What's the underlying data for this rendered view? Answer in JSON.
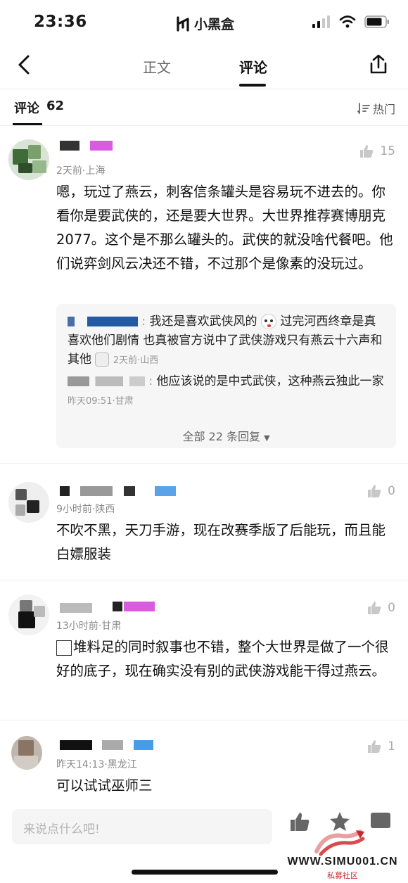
{
  "status_bar": {
    "time": "23:36",
    "app_name": "小黑盒"
  },
  "nav": {
    "tab_body": "正文",
    "tab_comments": "评论",
    "active_tab": "评论"
  },
  "comments_header": {
    "label": "评论",
    "count": "62",
    "sort_label": "热门"
  },
  "comments": [
    {
      "meta": "2天前·上海",
      "text": "嗯，玩过了燕云，刺客信条罐头是容易玩不进去的。你看你是要武侠的，还是要大世界。大世界推荐赛博朋克2077。这个是不那么罐头的。武侠的就没啥代餐吧。他们说弈剑风云决还不错，不过那个是像素的没玩过。",
      "likes": "15",
      "replies": [
        {
          "text": "我还是喜欢武侠风的",
          "text2": "过完河西终章是真喜欢他们剧情 也真被官方说中了武侠游戏只有燕云十六声和其他",
          "meta": "2天前·山西"
        },
        {
          "text": "他应该说的是中式武侠，这种燕云独此一家",
          "meta": "昨天09:51·甘肃"
        }
      ],
      "more_replies": "全部 22 条回复"
    },
    {
      "meta": "9小时前·陕西",
      "text": "不吹不黑，天刀手游，现在改赛季版了后能玩，而且能白嫖服装",
      "likes": "0"
    },
    {
      "meta": "13小时前·甘肃",
      "text": "堆料足的同时叙事也不错，整个大世界是做了一个很好的底子，现在确实没有别的武侠游戏能干得过燕云。",
      "likes": "0"
    },
    {
      "meta": "昨天14:13·黑龙江",
      "text": "可以试试巫师三",
      "likes": "1"
    }
  ],
  "bottom_bar": {
    "input_placeholder": "来说点什么吧!"
  },
  "watermark": {
    "site": "WWW.SIMU001.CN",
    "sub": "私募社区"
  },
  "colors": {
    "accent": "#111111",
    "meta_gray": "#8a8a8a",
    "reply_bg": "#f6f6f7",
    "watermark_red": "#c8282c"
  }
}
